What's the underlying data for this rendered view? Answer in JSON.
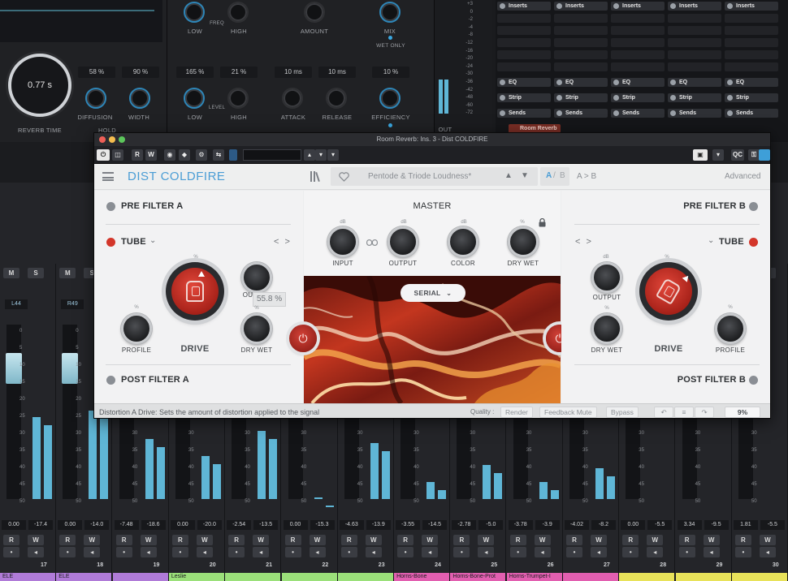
{
  "reverb": {
    "time_display": "0.77 s",
    "reverb_time_label": "REVERB TIME",
    "diffusion_value": "58 %",
    "diffusion_label": "DIFFUSION",
    "width_value": "90 %",
    "width_label": "WIDTH",
    "hold_label": "HOLD",
    "low1_label": "LOW",
    "freq_label": "FREQ",
    "high1_label": "HIGH",
    "amount_label": "AMOUNT",
    "mix_label": "MIX",
    "wet_only_label": "WET ONLY",
    "level_low_value": "165 %",
    "level_high_value": "21 %",
    "level_label": "LEVEL",
    "low2_label": "LOW",
    "high2_label": "HIGH",
    "attack_value": "10 ms",
    "attack_label": "ATTACK",
    "release_value": "10 ms",
    "release_label": "RELEASE",
    "efficiency_value": "10 %",
    "efficiency_label": "EFFICIENCY",
    "meter_out_label": "OUT",
    "meter_scale": [
      "+3",
      "0",
      "-2",
      "-4",
      "-8",
      "-12",
      "-16",
      "-20",
      "-24",
      "-30",
      "-36",
      "-42",
      "-48",
      "-60",
      "-72"
    ]
  },
  "inserts": {
    "columns": 5,
    "inserts_label": "Inserts",
    "eq_label": "EQ",
    "strip_label": "Strip",
    "sends_label": "Sends",
    "room_reverb_label": "Room Reverb"
  },
  "plugin": {
    "window_title": "Room Reverb: Ins. 3 - Dist COLDFIRE",
    "host_buttons": [
      "R",
      "W"
    ],
    "qc_label": "QC",
    "brand": "DIST COLDFIRE",
    "preset_name": "Pentode & Triode Loudness*",
    "ab_a": "A",
    "ab_sep": "/",
    "ab_b": "B",
    "a_to_b": "A > B",
    "advanced": "Advanced",
    "left": {
      "pre_filter": "PRE FILTER A",
      "mode": "TUBE",
      "nav": "< >",
      "profile": "PROFILE",
      "drive": "DRIVE",
      "output": "OU",
      "dry_wet": "DRY WET",
      "tooltip": "55.8 %",
      "post_filter": "POST FILTER A",
      "pct": "%",
      "db": "dB"
    },
    "master": {
      "title": "MASTER",
      "input": "INPUT",
      "output": "OUTPUT",
      "color": "COLOR",
      "dry_wet": "DRY WET",
      "db": "dB",
      "pct": "%",
      "routing": "SERIAL"
    },
    "right": {
      "pre_filter": "PRE FILTER B",
      "mode": "TUBE",
      "nav": "< >",
      "output": "OUTPUT",
      "dry_wet": "DRY WET",
      "drive": "DRIVE",
      "profile": "PROFILE",
      "post_filter": "POST FILTER B",
      "pct": "%",
      "db": "dB"
    },
    "status": {
      "message": "Distortion A Drive: Sets the amount of distortion applied to the signal",
      "quality_label": "Quality :",
      "render": "Render",
      "feedback_mute": "Feedback Mute",
      "bypass": "Bypass",
      "cpu": "9%"
    }
  },
  "mixer": {
    "scale": [
      "0",
      "5",
      "10",
      "15",
      "20",
      "25",
      "30",
      "35",
      "40",
      "45",
      "50"
    ],
    "channels": [
      {
        "pan": "L44",
        "vol": "0.00",
        "peak": "-17.4",
        "num": "17",
        "name": "ELE",
        "color": "#b07bd8",
        "meter": 0.48
      },
      {
        "pan": "R49",
        "vol": "0.00",
        "peak": "-14.0",
        "num": "18",
        "name": "ELE",
        "color": "#b07bd8",
        "meter": 0.52
      },
      {
        "pan": "",
        "vol": "-7.48",
        "peak": "-18.6",
        "num": "19",
        "name": "",
        "color": "#b07bd8",
        "meter": 0.35
      },
      {
        "pan": "",
        "vol": "0.00",
        "peak": "-20.0",
        "num": "20",
        "name": "Leslie",
        "color": "#9be07a",
        "meter": 0.25
      },
      {
        "pan": "",
        "vol": "-2.54",
        "peak": "-13.5",
        "num": "21",
        "name": "",
        "color": "#9be07a",
        "meter": 0.4
      },
      {
        "pan": "",
        "vol": "0.00",
        "peak": "-15.3",
        "num": "22",
        "name": "",
        "color": "#9be07a",
        "meter": 0.01
      },
      {
        "pan": "",
        "vol": "-4.63",
        "peak": "-13.9",
        "num": "23",
        "name": "",
        "color": "#9be07a",
        "meter": 0.33
      },
      {
        "pan": "",
        "vol": "-3.55",
        "peak": "-14.5",
        "num": "24",
        "name": "Horns-Bone",
        "color": "#e25fb0",
        "meter": 0.1
      },
      {
        "pan": "",
        "vol": "-2.78",
        "peak": "-5.0",
        "num": "25",
        "name": "Horns-Bone-Prot",
        "color": "#e25fb0",
        "meter": 0.2
      },
      {
        "pan": "",
        "vol": "-3.78",
        "peak": "-3.9",
        "num": "26",
        "name": "Horns-Trumpet-I",
        "color": "#e25fb0",
        "meter": 0.1
      },
      {
        "pan": "",
        "vol": "-4.02",
        "peak": "-8.2",
        "num": "27",
        "name": "",
        "color": "#e25fb0",
        "meter": 0.18
      },
      {
        "pan": "",
        "vol": "0.00",
        "peak": "-5.5",
        "num": "28",
        "name": "",
        "color": "#e8e25a",
        "meter": 0.0
      },
      {
        "pan": "",
        "vol": "3.34",
        "peak": "-9.5",
        "num": "29",
        "name": "",
        "color": "#e8e25a",
        "meter": 0.0
      },
      {
        "pan": "",
        "vol": "1.81",
        "peak": "-5.5",
        "num": "30",
        "name": "",
        "color": "#e8e25a",
        "meter": 0.0
      }
    ]
  }
}
